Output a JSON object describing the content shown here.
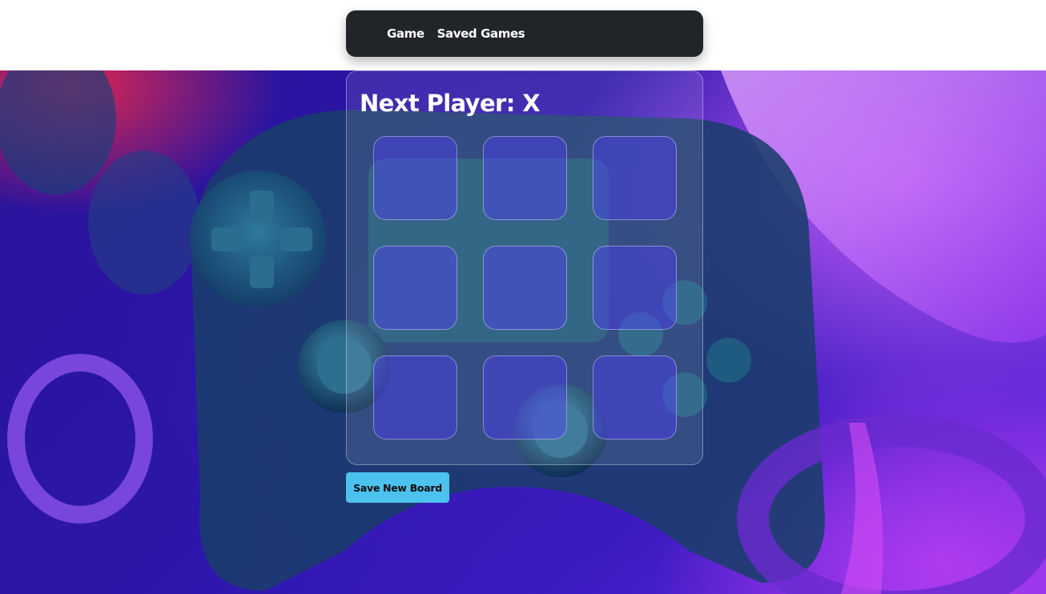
{
  "navbar": {
    "links": [
      "Game",
      "Saved Games"
    ]
  },
  "game": {
    "status_text": "Next Player: X",
    "cells": [
      "",
      "",
      "",
      "",
      "",
      "",
      "",
      "",
      ""
    ]
  },
  "actions": {
    "save_label": "Save New Board"
  },
  "colors": {
    "navbar_bg": "#212428",
    "save_button_bg": "#4cc2ee",
    "background_primary": "#2b16a8",
    "background_accent": "#c05cf5"
  },
  "icons": {
    "background": "gaming-controller-background-image"
  }
}
